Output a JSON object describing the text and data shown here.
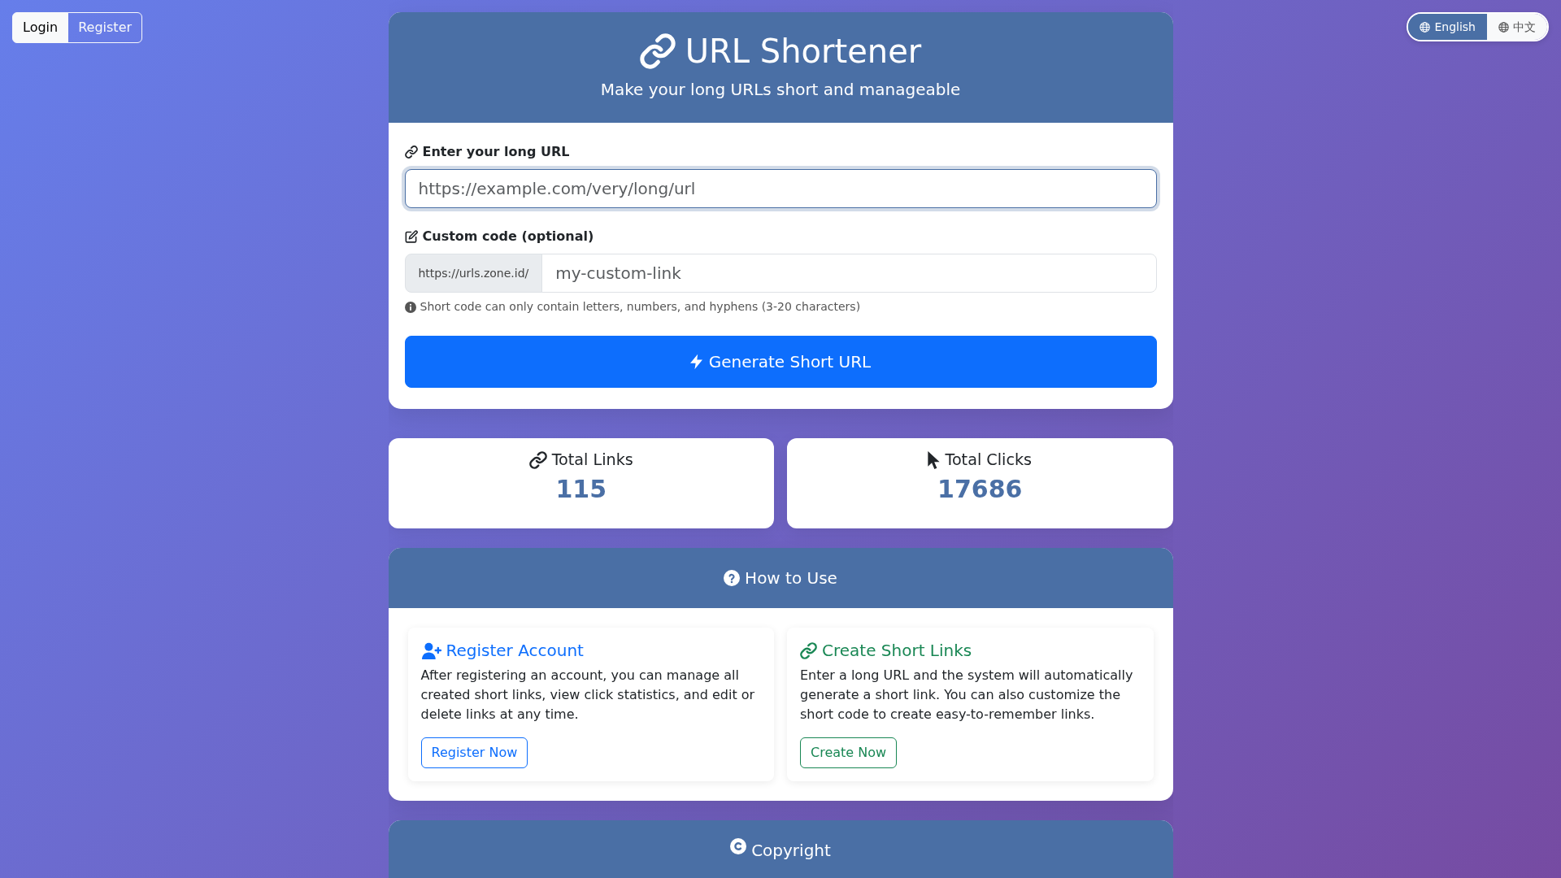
{
  "auth_buttons": [
    {
      "label": "Login",
      "selected": true
    },
    {
      "label": "Register",
      "selected": false
    }
  ],
  "language_switch": [
    {
      "label": "English",
      "selected": true
    },
    {
      "label": "中文",
      "selected": false
    }
  ],
  "header": {
    "title": "URL Shortener",
    "subtitle": "Make your long URLs short and manageable"
  },
  "form": {
    "fields": [
      {
        "kind": "url",
        "label": "Enter your long URL",
        "placeholder": "https://example.com/very/long/url",
        "focused": true
      },
      {
        "kind": "custom_code",
        "label": "Custom code (optional)",
        "prefix": "https://urls.zone.id/",
        "placeholder": "my-custom-link",
        "hint": "Short code can only contain letters, numbers, and hyphens (3-20 characters)",
        "focused": false
      }
    ],
    "submit_button": "Generate Short URL"
  },
  "stats": [
    {
      "kind": "links",
      "label": "Total Links",
      "value": "115"
    },
    {
      "kind": "clicks",
      "label": "Total Clicks",
      "value": "17686"
    }
  ],
  "how_to_use": {
    "title": "How to Use",
    "steps": [
      {
        "kind": "register",
        "title": "Register Account",
        "text": "After registering an account, you can manage all created short links, view click statistics, and edit or delete links at any time.",
        "button": "Register Now"
      },
      {
        "kind": "create",
        "title": "Create Short Links",
        "text": "Enter a long URL and the system will automatically generate a short link. You can also customize the short code to create easy-to-remember links.",
        "button": "Create Now"
      }
    ]
  },
  "footer": {
    "title": "Copyright"
  }
}
